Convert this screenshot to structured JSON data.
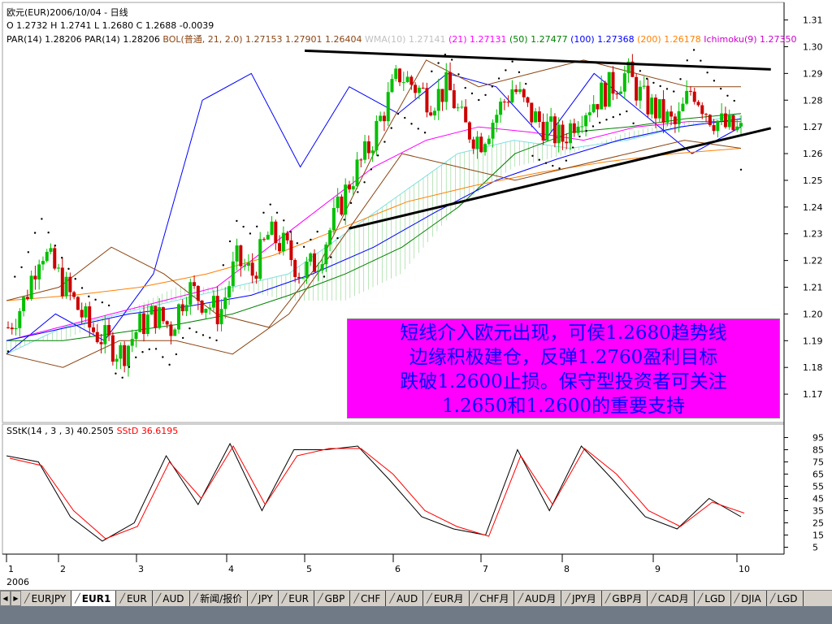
{
  "header": {
    "title": "欧元(EUR)2006/10/04 - 日线",
    "ohlc": {
      "open_label": "O",
      "open": "1.2732",
      "high_label": "H",
      "high": "1.2741",
      "low_label": "L",
      "low": "1.2680",
      "close_label": "C",
      "close": "1.2688",
      "change": "-0.0039"
    },
    "indicators": [
      {
        "text": "PAR(14)   1.28206",
        "color": "#000000"
      },
      {
        "text": "PAR(14)   1.28206",
        "color": "#000000"
      },
      {
        "text": "BOL(普通, 21, 2.0)  1.27153",
        "color": "#8b4513"
      },
      {
        "text": "1.27901",
        "color": "#8b4513"
      },
      {
        "text": "1.26404",
        "color": "#8b4513"
      },
      {
        "text": "WMA(10) 1.27141",
        "color": "#c0c0c0"
      },
      {
        "text": "(21) 1.27131",
        "color": "#ff00ff"
      },
      {
        "text": "(50) 1.27477",
        "color": "#008000"
      },
      {
        "text": "(100) 1.27368",
        "color": "#0000ff"
      },
      {
        "text": "(200) 1.26178",
        "color": "#ff8000"
      },
      {
        "text": "Ichimoku(9) 1.27350",
        "color": "#cc00cc"
      }
    ]
  },
  "annotation": {
    "lines": [
      "短线介入欧元出现，可侯1.2680趋势线",
      "边缘积极建仓，反弹1.2760盈利目标",
      "跌破1.2600止损。保守型投资者可关注",
      "1.2650和1.2600的重要支持"
    ]
  },
  "stoch_header": {
    "label": "SStK(14 , 3 , 3)",
    "value": "40.2505",
    "d_label": "SStD",
    "d_value": "36.6195",
    "k_color": "#000000",
    "d_color": "#ff0000"
  },
  "price_axis": {
    "ticks": [
      "1.31",
      "1.30",
      "1.29",
      "1.28",
      "1.27",
      "1.26",
      "1.25",
      "1.24",
      "1.23",
      "1.22",
      "1.21",
      "1.20",
      "1.19",
      "1.18",
      "1.17"
    ],
    "min": 1.16,
    "max": 1.312
  },
  "stoch_axis": {
    "ticks": [
      "95",
      "85",
      "75",
      "65",
      "55",
      "45",
      "35",
      "25",
      "15",
      "5"
    ],
    "min": 0,
    "max": 100
  },
  "time_axis": {
    "months": [
      "1",
      "2",
      "3",
      "4",
      "5",
      "6",
      "7",
      "8",
      "9",
      "10"
    ],
    "year": "2006"
  },
  "tabs": [
    {
      "label": "EURJPY",
      "active": false
    },
    {
      "label": "EUR1",
      "active": true
    },
    {
      "label": "EUR",
      "active": false
    },
    {
      "label": "AUD",
      "active": false
    },
    {
      "label": "新闻/报价",
      "active": false
    },
    {
      "label": "JPY",
      "active": false
    },
    {
      "label": "EUR",
      "active": false
    },
    {
      "label": "GBP",
      "active": false
    },
    {
      "label": "CHF",
      "active": false
    },
    {
      "label": "AUD",
      "active": false
    },
    {
      "label": "EUR月",
      "active": false
    },
    {
      "label": "CHF月",
      "active": false
    },
    {
      "label": "AUD月",
      "active": false
    },
    {
      "label": "JPY月",
      "active": false
    },
    {
      "label": "GBP月",
      "active": false
    },
    {
      "label": "CAD月",
      "active": false
    },
    {
      "label": "LGD",
      "active": false
    },
    {
      "label": "DJIA",
      "active": false
    },
    {
      "label": "LGD",
      "active": false
    }
  ],
  "colors": {
    "up_candle": "#00c000",
    "down_candle": "#cc0000",
    "cloud": "#80e0e0",
    "wma": "#c0c0c0",
    "ma21": "#ff00ff",
    "ma50": "#008000",
    "ma100": "#0000ff",
    "ma200": "#ff8000",
    "bollinger": "#8b4513",
    "annotation_bg": "#ff00ff",
    "annotation_text": "#0000ff"
  },
  "chart_data": {
    "type": "line",
    "xlabel": "",
    "ylabel": "",
    "ylim": [
      1.16,
      1.312
    ],
    "grid": false,
    "trendlines": [
      {
        "name": "resistance",
        "from": [
          "2006-05-01",
          1.2985
        ],
        "to": [
          "2006-10-05",
          1.2915
        ]
      },
      {
        "name": "support",
        "from": [
          "2006-05-16",
          1.232
        ],
        "to": [
          "2006-10-05",
          1.2695
        ]
      }
    ],
    "series": [
      {
        "values": [
          1.195,
          1.205,
          1.225,
          1.215,
          1.205,
          1.195,
          1.19,
          1.185,
          1.195,
          1.2,
          1.195,
          1.21,
          1.205,
          1.2,
          1.22,
          1.215,
          1.23,
          1.225,
          1.215,
          1.22,
          1.235,
          1.25,
          1.26,
          1.275,
          1.29,
          1.285,
          1.28,
          1.285,
          1.27,
          1.265,
          1.275,
          1.285,
          1.275,
          1.27,
          1.265,
          1.275,
          1.28,
          1.285,
          1.29,
          1.28,
          1.275,
          1.27,
          1.285,
          1.275,
          1.27,
          1.268
        ]
      },
      {
        "values": [
          1.185,
          1.2,
          1.19,
          1.215,
          1.28,
          1.29,
          1.255,
          1.285,
          1.275,
          1.29,
          1.285,
          1.265,
          1.29,
          1.275,
          1.26,
          1.27
        ]
      },
      {
        "values": [
          1.19,
          1.195,
          1.2,
          1.205,
          1.21,
          1.225,
          1.24,
          1.255,
          1.265,
          1.27,
          1.268,
          1.265,
          1.27,
          1.272,
          1.272
        ]
      },
      {
        "values": [
          1.19,
          1.19,
          1.193,
          1.196,
          1.2,
          1.207,
          1.215,
          1.225,
          1.24,
          1.26,
          1.268,
          1.27,
          1.273,
          1.275
        ]
      },
      {
        "values": [
          1.19,
          1.195,
          1.2,
          1.203,
          1.207,
          1.215,
          1.225,
          1.238,
          1.25,
          1.258,
          1.265,
          1.27,
          1.273
        ]
      },
      {
        "values": [
          1.205,
          1.207,
          1.21,
          1.215,
          1.222,
          1.232,
          1.242,
          1.248,
          1.253,
          1.257,
          1.26,
          1.262
        ]
      },
      {
        "values": [
          1.205,
          1.21,
          1.225,
          1.215,
          1.2,
          1.195,
          1.22,
          1.26,
          1.295,
          1.285,
          1.29,
          1.295,
          1.29,
          1.285,
          1.285
        ]
      },
      {
        "values": [
          1.185,
          1.18,
          1.19,
          1.19,
          1.185,
          1.2,
          1.23,
          1.26,
          1.255,
          1.25,
          1.255,
          1.26,
          1.265,
          1.262
        ]
      },
      {
        "values": [
          80,
          75,
          30,
          10,
          25,
          80,
          40,
          90,
          35,
          85,
          85,
          88,
          60,
          30,
          20,
          15,
          85,
          35,
          88,
          60,
          30,
          20,
          45,
          30
        ]
      },
      {
        "values": [
          78,
          72,
          35,
          12,
          22,
          75,
          45,
          88,
          40,
          80,
          86,
          86,
          65,
          35,
          22,
          14,
          80,
          40,
          86,
          65,
          35,
          22,
          42,
          33
        ]
      }
    ]
  }
}
